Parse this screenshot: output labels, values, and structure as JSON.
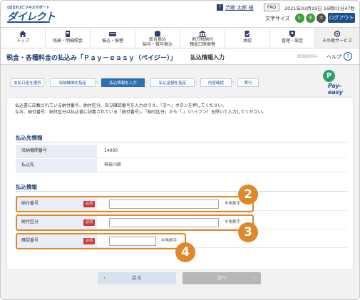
{
  "header": {
    "logo_sub": "(ほまれ)ビジネスサポート",
    "logo_main": "ダイレクト",
    "user_icon": "?",
    "user_name": "渋郷 太郎 様",
    "faq": "FAQ",
    "datetime": "2021年03月19日 16時01分47秒",
    "font_size_label": "文字サイズ",
    "font_small": "小",
    "font_medium": "中",
    "font_large": "大",
    "logout": "ログアウト"
  },
  "nav": {
    "items": [
      {
        "label": "トップ",
        "icon": "home-icon"
      },
      {
        "label": "残高・明細照会",
        "icon": "document-icon"
      },
      {
        "label": "振込・振替",
        "icon": "transfer-icon"
      },
      {
        "label": "総合振込\n給与・賞与振込",
        "icon": "coins-icon"
      },
      {
        "label": "地方税納付\n預金口座振替",
        "icon": "building-icon"
      },
      {
        "label": "承認",
        "icon": "approve-icon"
      },
      {
        "label": "管理・設定",
        "icon": "settings-icon"
      },
      {
        "label": "その他サービス",
        "icon": "other-service-icon"
      }
    ]
  },
  "titlebar": {
    "title": "税金・各種料金の払込み「Ｐａｙ－ｅａｓｙ（ペイジー）」",
    "subtitle": "払込情報入力",
    "screen_id": "BSNS004",
    "help": "ヘルプ",
    "help_icon": "?"
  },
  "steps": [
    "支払口座を選択",
    "収納機関を指定",
    "払込情報を入力",
    "払込金額を指定",
    "内容確認",
    "実行"
  ],
  "active_step": 2,
  "payeasy": {
    "mark": "P",
    "text": "Pay-easy"
  },
  "note": {
    "line1": "払込書に記載されている納付番号、納付区分、及び確認番号を入力のうえ、「次へ」ボタンを押してください。",
    "line2": "なお、納付番号、納付区分は払込書に記載されている「納付番号」、「納付区分」から「-」（ハイフン）を除いて入力してください。"
  },
  "payee_section": {
    "title": "払込先情報",
    "rows": [
      {
        "label": "収納機関番号",
        "value": "14000"
      },
      {
        "label": "払込先",
        "value": "神奈川県"
      }
    ]
  },
  "payment_section": {
    "title": "払込情報",
    "required": "必須",
    "rows": [
      {
        "label": "納付番号",
        "hint": "半角数字"
      },
      {
        "label": "納付区分",
        "hint": "半角数字"
      },
      {
        "label": "確認番号",
        "hint": "半角数字"
      }
    ]
  },
  "badges": [
    "2",
    "3",
    "4"
  ],
  "buttons": {
    "back": "戻る",
    "next": "次へ",
    "back_chevron": "‹",
    "next_chevron": "›"
  },
  "colors": {
    "brand": "#1b4f91",
    "accent": "#e0872a",
    "required": "#c83b3b",
    "active_step": "#2f6db4"
  }
}
